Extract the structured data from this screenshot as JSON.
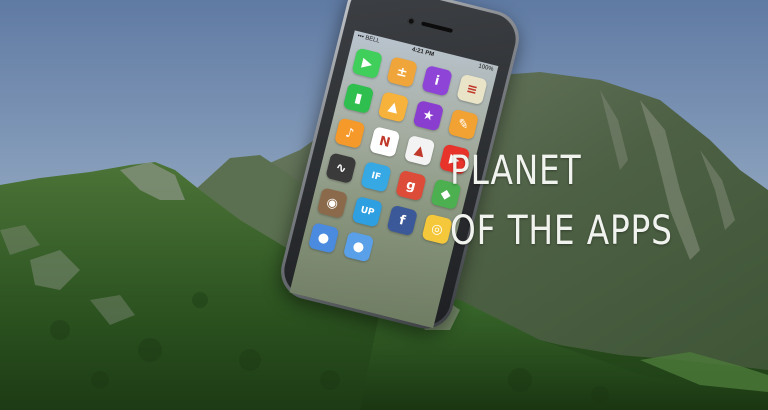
{
  "title": {
    "line1": "PLANET",
    "line2": "OF THE APPS"
  },
  "phone": {
    "status_bar": {
      "carrier": "••• BELL",
      "time": "4:21 PM",
      "battery": "100%"
    },
    "apps": [
      {
        "icon": "facetime-icon",
        "color": "#3fcf5a",
        "glyph": "▶"
      },
      {
        "icon": "calculator-icon",
        "color": "#f0a53a",
        "glyph": "±"
      },
      {
        "icon": "info-icon",
        "color": "#8e44d6",
        "glyph": "i"
      },
      {
        "icon": "notes-icon",
        "color": "#e9e3c8",
        "glyph": "≡"
      },
      {
        "icon": "numbers-icon",
        "color": "#2fbf4f",
        "glyph": "▮"
      },
      {
        "icon": "itunesu-icon",
        "color": "#f6b23a",
        "glyph": "▲"
      },
      {
        "icon": "star-icon",
        "color": "#8a3ed0",
        "glyph": "★"
      },
      {
        "icon": "pages-icon",
        "color": "#f2a232",
        "glyph": "✎"
      },
      {
        "icon": "garageband-icon",
        "color": "#f59a2a",
        "glyph": "♪"
      },
      {
        "icon": "netflix-icon",
        "color": "#ffffff",
        "glyph": "N"
      },
      {
        "icon": "drive-icon",
        "color": "#f3f3f3",
        "glyph": "▲"
      },
      {
        "icon": "youtube-icon",
        "color": "#e8332b",
        "glyph": "▶"
      },
      {
        "icon": "stocks-icon",
        "color": "#3a3a3a",
        "glyph": "∿"
      },
      {
        "icon": "iftt-icon",
        "color": "#36a8e4",
        "glyph": "IF"
      },
      {
        "icon": "google-plus-icon",
        "color": "#dd4b39",
        "glyph": "g"
      },
      {
        "icon": "maps-icon",
        "color": "#4caf50",
        "glyph": "◆"
      },
      {
        "icon": "instagram-icon",
        "color": "#8a6a4a",
        "glyph": "◉"
      },
      {
        "icon": "up-icon",
        "color": "#2e9fe0",
        "glyph": "UP"
      },
      {
        "icon": "facebook-icon",
        "color": "#3b5998",
        "glyph": "f"
      },
      {
        "icon": "chrome-icon",
        "color": "#f5c73a",
        "glyph": "◎"
      },
      {
        "icon": "dock-app-1-icon",
        "color": "#4a8be0",
        "glyph": "●"
      },
      {
        "icon": "dock-app-2-icon",
        "color": "#5aa0e8",
        "glyph": "●"
      }
    ]
  },
  "colors": {
    "sky_top": "#6e88ad",
    "sky_bottom": "#b9c7d6",
    "mountain_far": "#5b6b55",
    "mountain_near": "#2f5a25",
    "title_text": "#f1f3ee"
  }
}
